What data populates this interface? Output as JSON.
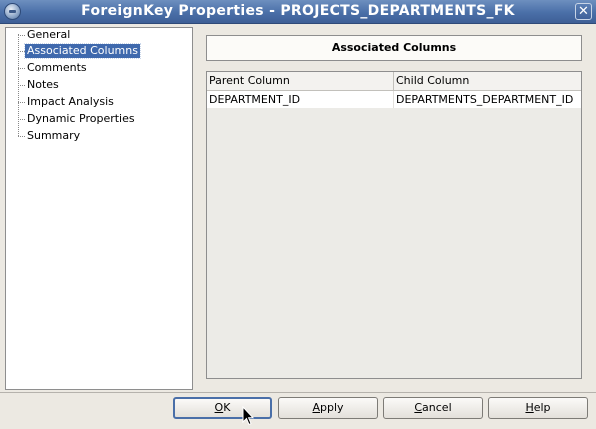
{
  "window": {
    "title": "ForeignKey Properties - PROJECTS_DEPARTMENTS_FK"
  },
  "nav": {
    "items": [
      {
        "label": "General",
        "selected": false
      },
      {
        "label": "Associated Columns",
        "selected": true
      },
      {
        "label": "Comments",
        "selected": false
      },
      {
        "label": "Notes",
        "selected": false
      },
      {
        "label": "Impact Analysis",
        "selected": false
      },
      {
        "label": "Dynamic Properties",
        "selected": false
      },
      {
        "label": "Summary",
        "selected": false
      }
    ]
  },
  "panel": {
    "header": "Associated Columns",
    "table": {
      "columns": [
        "Parent Column",
        "Child Column"
      ],
      "rows": [
        [
          "DEPARTMENT_ID",
          "DEPARTMENTS_DEPARTMENT_ID"
        ]
      ]
    }
  },
  "buttons": {
    "ok": {
      "label": "OK",
      "mnemonic": "O",
      "rest": "K"
    },
    "apply": {
      "label": "Apply",
      "mnemonic": "A",
      "rest": "pply"
    },
    "cancel": {
      "label": "Cancel",
      "mnemonic": "C",
      "rest": "ancel"
    },
    "help": {
      "label": "Help",
      "mnemonic": "H",
      "rest": "elp"
    }
  },
  "icons": {
    "app": "java-app-icon",
    "close": "close-icon",
    "cursor": "mouse-pointer-icon"
  }
}
